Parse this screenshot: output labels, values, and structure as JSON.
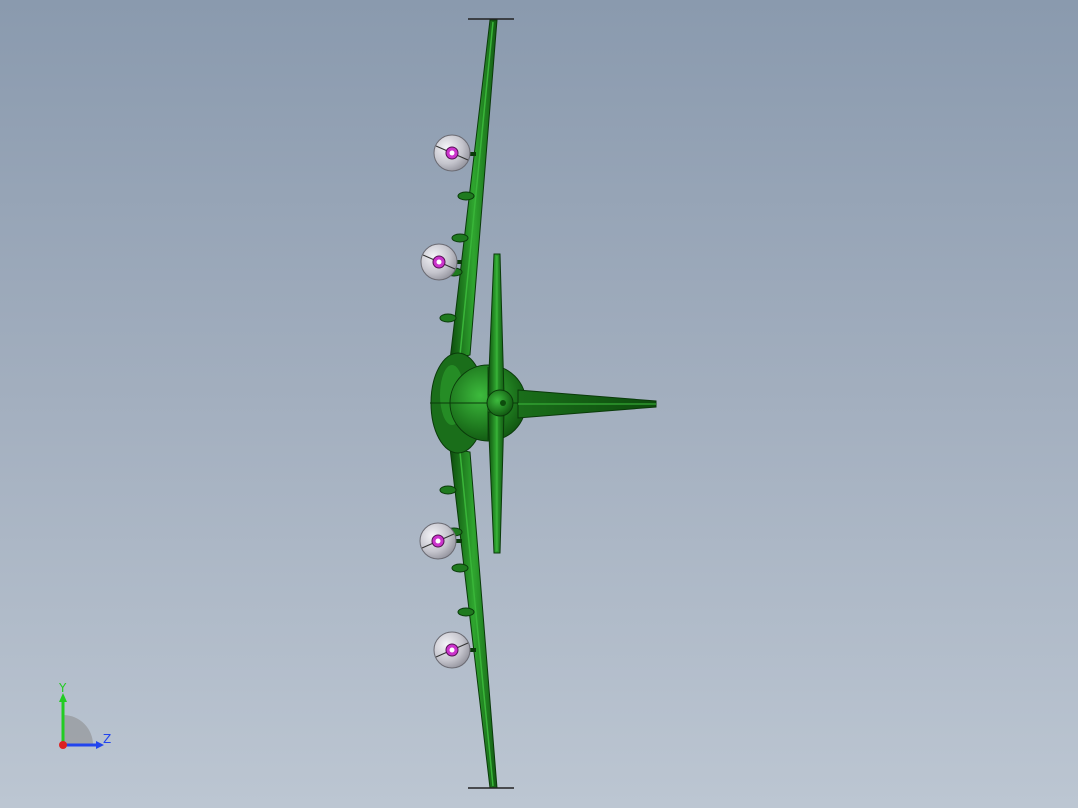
{
  "viewport": {
    "background_top": "#8a9aae",
    "background_bottom": "#bcc6d2"
  },
  "model": {
    "body_color": "#1f7a1f",
    "body_highlight": "#2fa52f",
    "body_dark": "#0d4d0d",
    "engine_color": "#c8c8d0",
    "engine_hub_color": "#cc33cc"
  },
  "triad": {
    "y_label": "Y",
    "z_label": "Z",
    "y_color": "#22cc22",
    "z_color": "#2244ee",
    "x_color": "#dd2222"
  }
}
